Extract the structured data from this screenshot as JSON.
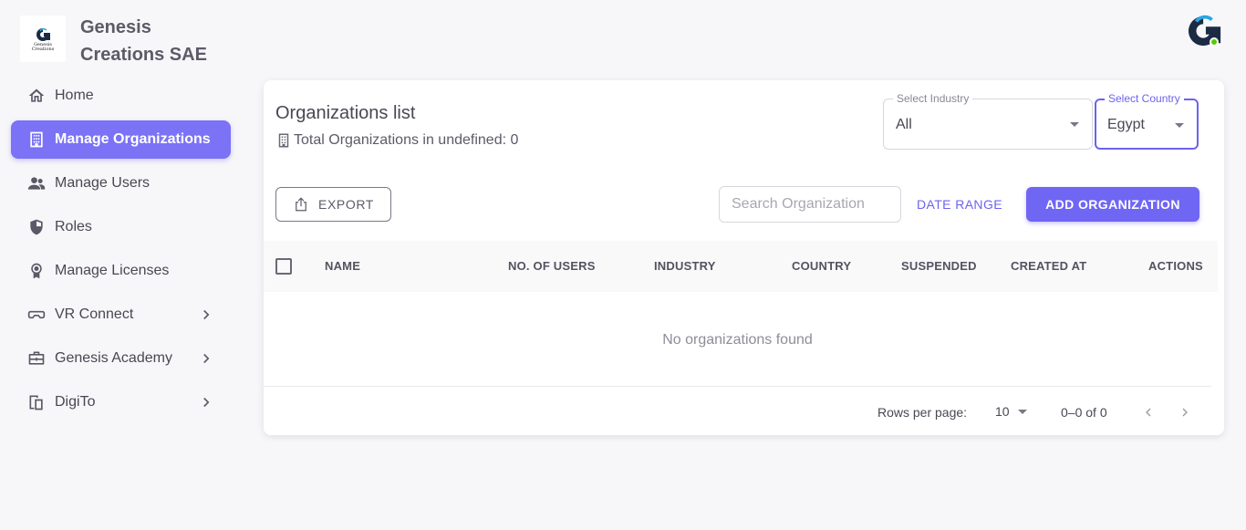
{
  "brand": {
    "name": "Genesis Creations SAE",
    "logo_text_1": "Genesis",
    "logo_text_2": "Creations"
  },
  "nav": [
    {
      "label": "Home",
      "icon": "home-icon",
      "active": false
    },
    {
      "label": "Manage Organizations",
      "icon": "building-icon",
      "active": true
    },
    {
      "label": "Manage Users",
      "icon": "users-icon",
      "active": false
    },
    {
      "label": "Roles",
      "icon": "shield-icon",
      "active": false
    },
    {
      "label": "Manage Licenses",
      "icon": "license-badge-icon",
      "active": false
    },
    {
      "label": "VR Connect",
      "icon": "vr-headset-icon",
      "active": false,
      "expandable": true
    },
    {
      "label": "Genesis Academy",
      "icon": "briefcase-icon",
      "active": false,
      "expandable": true
    },
    {
      "label": "DigiTo",
      "icon": "devices-icon",
      "active": false,
      "expandable": true
    }
  ],
  "card": {
    "title": "Organizations list",
    "subtitle": "Total Organizations in undefined: 0"
  },
  "filters": {
    "industry": {
      "label": "Select Industry",
      "value": "All"
    },
    "country": {
      "label": "Select Country",
      "value": "Egypt"
    }
  },
  "toolbar": {
    "export_label": "EXPORT",
    "search_placeholder": "Search Organization",
    "date_range_label": "DATE RANGE",
    "add_label": "ADD ORGANIZATION"
  },
  "table": {
    "columns": [
      "NAME",
      "NO. OF USERS",
      "INDUSTRY",
      "COUNTRY",
      "SUSPENDED",
      "CREATED AT",
      "ACTIONS"
    ],
    "empty_text": "No organizations found"
  },
  "pagination": {
    "rows_per_page_label": "Rows per page:",
    "rows_per_page": "10",
    "range": "0–0 of 0"
  },
  "colors": {
    "accent": "#7367f0",
    "online": "#56ca00"
  }
}
